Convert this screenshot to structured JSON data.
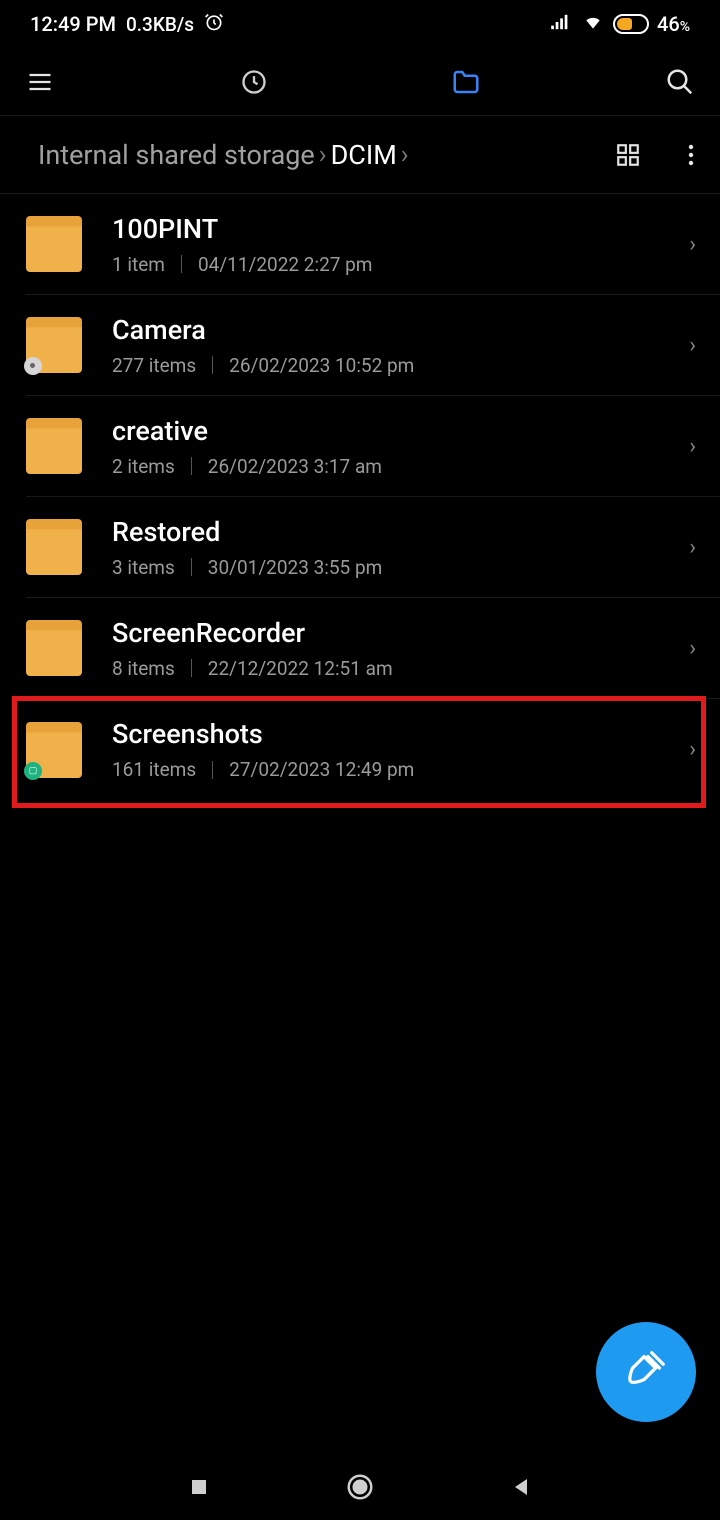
{
  "status": {
    "time": "12:49 PM",
    "speed": "0.3KB/s",
    "battery": "46",
    "battery_suffix": "%"
  },
  "breadcrumb": {
    "root": "Internal shared storage",
    "current": "DCIM"
  },
  "folders": [
    {
      "name": "100PINT",
      "count": "1 item",
      "date": "04/11/2022 2:27 pm",
      "overlay": ""
    },
    {
      "name": "Camera",
      "count": "277 items",
      "date": "26/02/2023 10:52 pm",
      "overlay": "gray"
    },
    {
      "name": "creative",
      "count": "2 items",
      "date": "26/02/2023 3:17 am",
      "overlay": ""
    },
    {
      "name": "Restored",
      "count": "3 items",
      "date": "30/01/2023 3:55 pm",
      "overlay": ""
    },
    {
      "name": "ScreenRecorder",
      "count": "8 items",
      "date": "22/12/2022 12:51 am",
      "overlay": ""
    },
    {
      "name": "Screenshots",
      "count": "161 items",
      "date": "27/02/2023 12:49 pm",
      "overlay": "green"
    }
  ]
}
